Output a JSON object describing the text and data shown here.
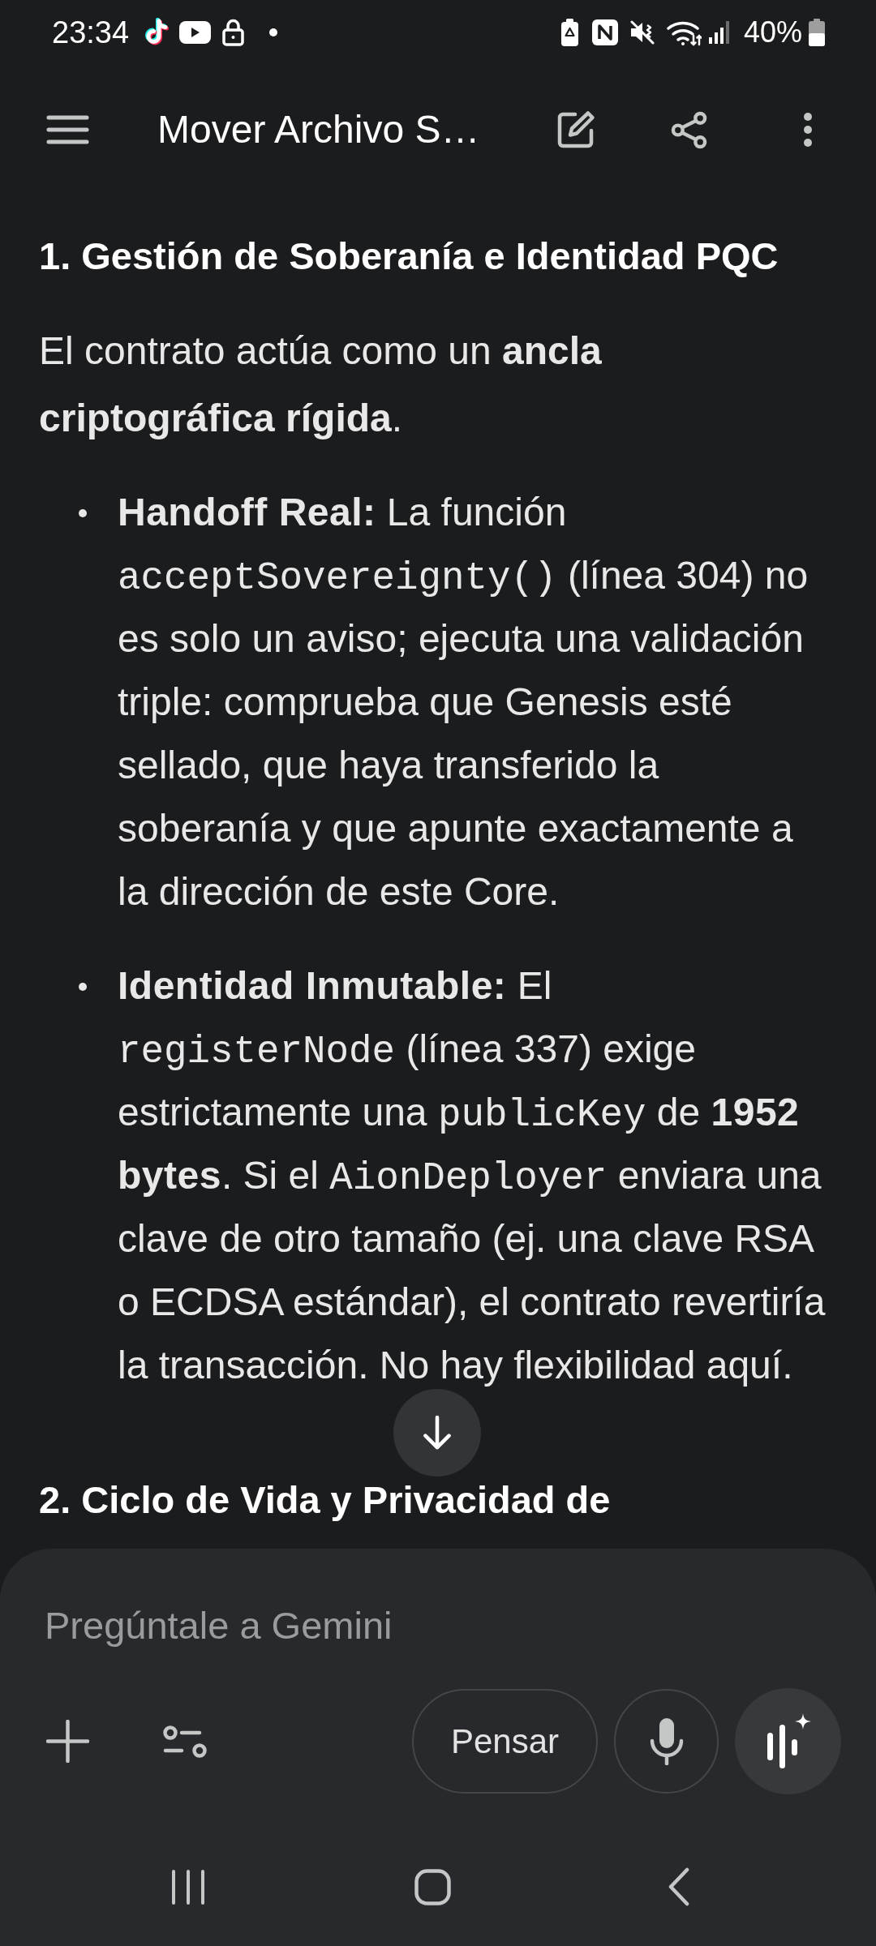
{
  "status_bar": {
    "time": "23:34",
    "battery": "40%"
  },
  "app_bar": {
    "title": "Mover Archivo S…"
  },
  "content": [
    {
      "kind": "heading",
      "text": "1. Gestión de Soberanía e Identidad PQC"
    },
    {
      "kind": "paragraph",
      "text": "El contrato actúa como un **ancla criptográfica rígida**."
    },
    {
      "kind": "bullet_list",
      "items": [
        {
          "runs": [
            {
              "kind": "text",
              "text": "**Handoff Real:** La función "
            },
            {
              "kind": "code",
              "text": "acceptSovereignty()"
            },
            {
              "kind": "text",
              "text": " (línea 304) no es solo un aviso; ejecuta una validación triple: comprueba que Genesis esté sellado, que haya transferido la soberanía y que apunte exactamente a la dirección de este Core."
            }
          ]
        },
        {
          "runs": [
            {
              "kind": "text",
              "text": "**Identidad Inmutable:** El "
            },
            {
              "kind": "code",
              "text": "registerNode"
            },
            {
              "kind": "text",
              "text": " (línea 337) exige estrictamente una "
            },
            {
              "kind": "code",
              "text": "publicKey"
            },
            {
              "kind": "text",
              "text": " de **1952 bytes**. Si el "
            },
            {
              "kind": "code",
              "text": "AionDeployer"
            },
            {
              "kind": "text",
              "text": " enviara una clave de otro tamaño (ej. una clave RSA o ECDSA estándar), el contrato revertiría la transacción. No hay flexibilidad aquí."
            }
          ]
        }
      ]
    },
    {
      "kind": "heading",
      "text": "2. Ciclo de Vida y Privacidad de"
    }
  ],
  "composer": {
    "placeholder": "Pregúntale a Gemini",
    "mode_button": "Pensar"
  }
}
